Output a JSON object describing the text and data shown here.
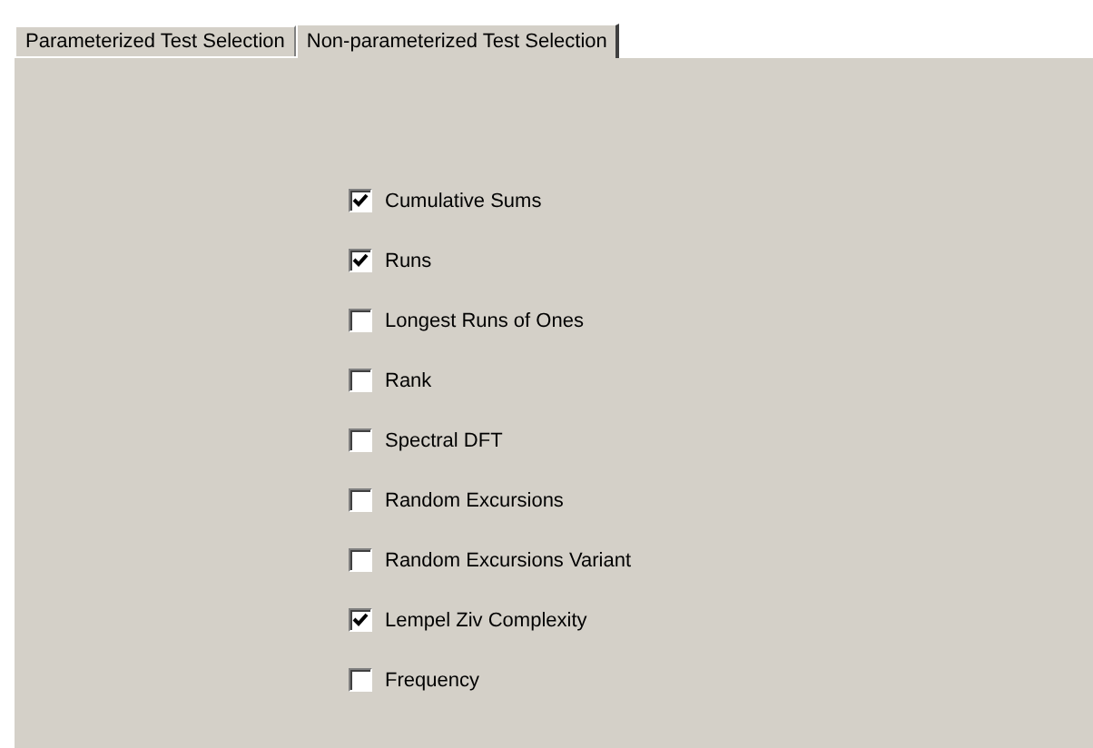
{
  "tabs": [
    {
      "label": "Parameterized Test Selection",
      "selected": false
    },
    {
      "label": "Non-parameterized Test Selection",
      "selected": true
    }
  ],
  "tests": [
    {
      "label": "Cumulative Sums",
      "checked": true
    },
    {
      "label": "Runs",
      "checked": true
    },
    {
      "label": "Longest Runs of Ones",
      "checked": false
    },
    {
      "label": "Rank",
      "checked": false
    },
    {
      "label": "Spectral DFT",
      "checked": false
    },
    {
      "label": "Random Excursions",
      "checked": false
    },
    {
      "label": "Random Excursions Variant",
      "checked": false
    },
    {
      "label": "Lempel Ziv Complexity",
      "checked": true
    },
    {
      "label": "Frequency",
      "checked": false
    }
  ]
}
